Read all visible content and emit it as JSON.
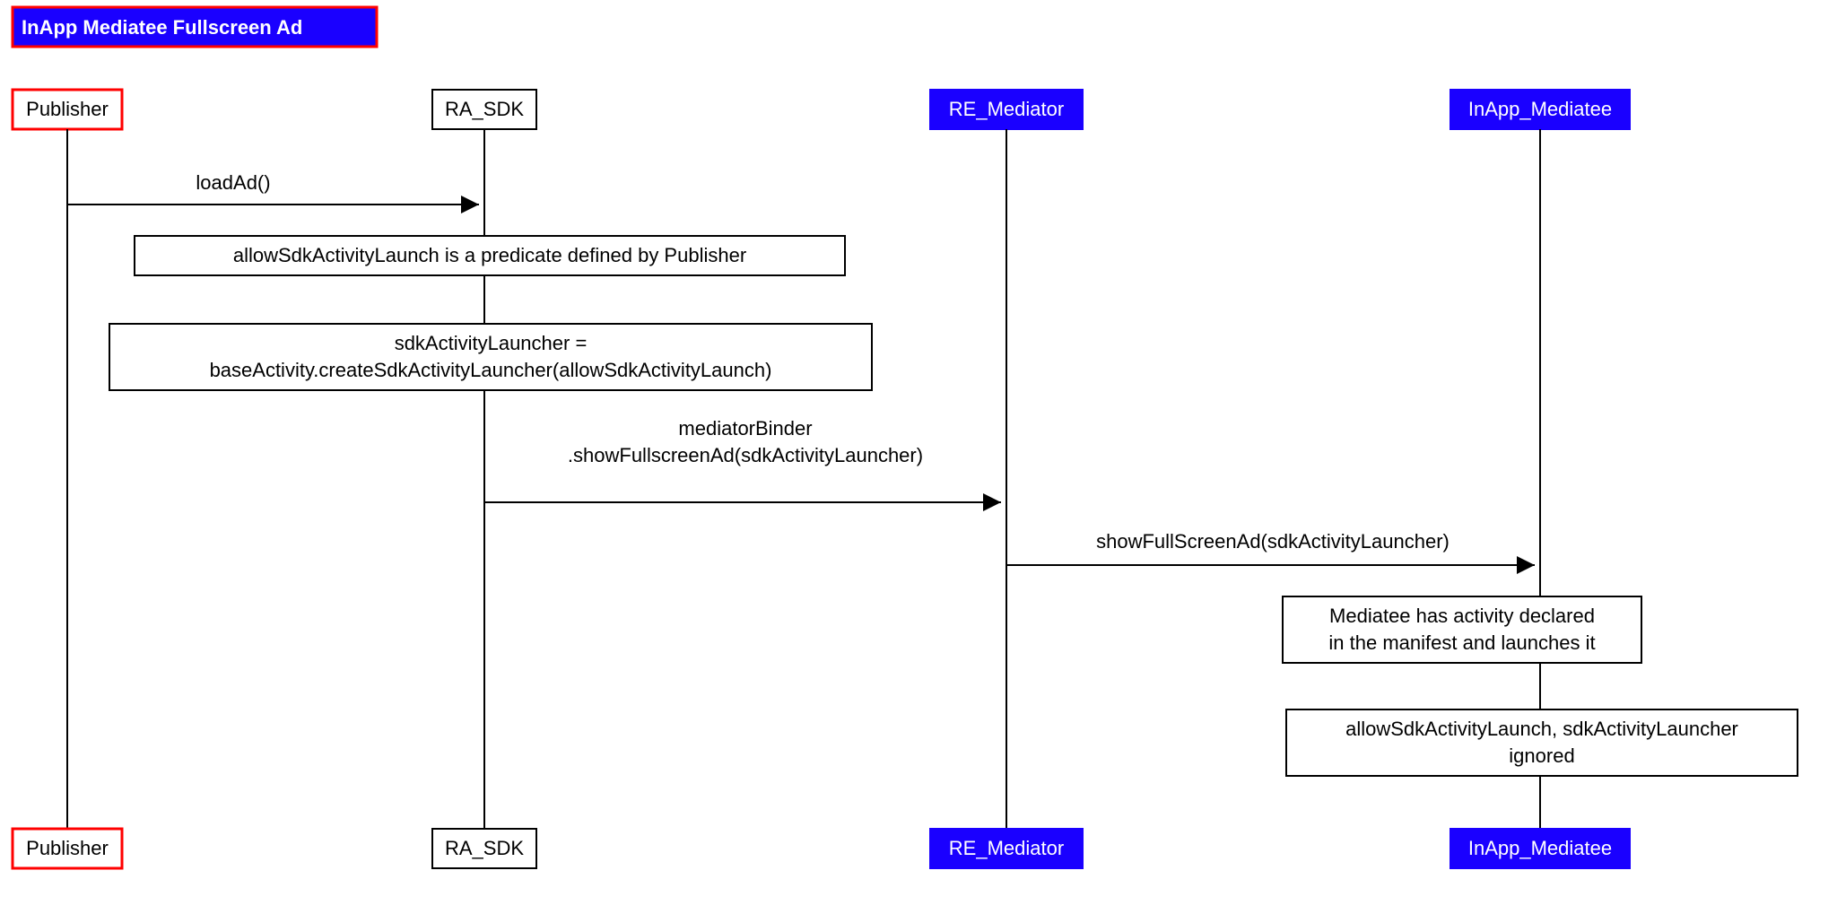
{
  "title": "InApp Mediatee Fullscreen Ad",
  "participants": {
    "p1": "Publisher",
    "p2": "RA_SDK",
    "p3": "RE_Mediator",
    "p4": "InApp_Mediatee"
  },
  "messages": {
    "m1": "loadAd()",
    "m2_l1": "mediatorBinder",
    "m2_l2": ".showFullscreenAd(sdkActivityLauncher)",
    "m3": "showFullScreenAd(sdkActivityLauncher)"
  },
  "notes": {
    "n1": "allowSdkActivityLaunch is a predicate defined by Publisher",
    "n2_l1": "sdkActivityLauncher =",
    "n2_l2": "baseActivity.createSdkActivityLauncher(allowSdkActivityLaunch)",
    "n3_l1": "Mediatee has activity declared",
    "n3_l2": "in the manifest and launches it",
    "n4_l1": "allowSdkActivityLaunch, sdkActivityLauncher",
    "n4_l2": "ignored"
  }
}
